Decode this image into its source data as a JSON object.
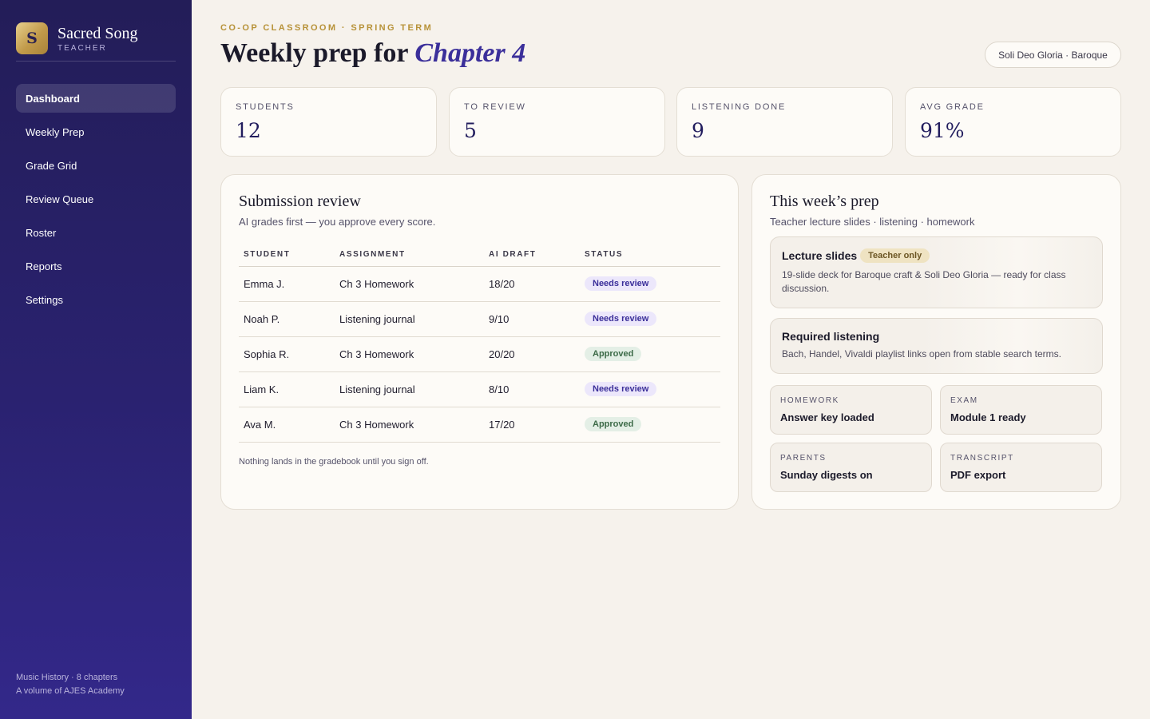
{
  "sidebar": {
    "logo_letter": "S",
    "app_name": "Sacred Song",
    "role": "TEACHER",
    "nav": [
      {
        "label": "Dashboard",
        "active": true
      },
      {
        "label": "Weekly Prep"
      },
      {
        "label": "Grade Grid"
      },
      {
        "label": "Review Queue"
      },
      {
        "label": "Roster"
      },
      {
        "label": "Reports"
      },
      {
        "label": "Settings"
      }
    ],
    "footer": {
      "line1": "Music History · 8 chapters",
      "line2": "A volume of AJES Academy"
    }
  },
  "header": {
    "eyebrow": "CO-OP CLASSROOM · SPRING TERM",
    "title_prefix": "Weekly prep for",
    "title_emphasis": "Chapter 4",
    "chip": "Soli Deo Gloria · Baroque"
  },
  "stats": [
    {
      "label": "STUDENTS",
      "value": "12"
    },
    {
      "label": "TO REVIEW",
      "value": "5"
    },
    {
      "label": "LISTENING DONE",
      "value": "9"
    },
    {
      "label": "AVG GRADE",
      "value": "91%"
    }
  ],
  "review": {
    "title": "Submission review",
    "subtitle": "AI grades first — you approve every score.",
    "columns": [
      "STUDENT",
      "ASSIGNMENT",
      "AI DRAFT",
      "STATUS"
    ],
    "rows": [
      {
        "student": "Emma J.",
        "assignment": "Ch 3 Homework",
        "draft": "18/20",
        "status": "Needs review"
      },
      {
        "student": "Noah P.",
        "assignment": "Listening journal",
        "draft": "9/10",
        "status": "Needs review"
      },
      {
        "student": "Sophia R.",
        "assignment": "Ch 3 Homework",
        "draft": "20/20",
        "status": "Approved"
      },
      {
        "student": "Liam K.",
        "assignment": "Listening journal",
        "draft": "8/10",
        "status": "Needs review"
      },
      {
        "student": "Ava M.",
        "assignment": "Ch 3 Homework",
        "draft": "17/20",
        "status": "Approved"
      }
    ],
    "footnote": "Nothing lands in the gradebook until you sign off."
  },
  "prep": {
    "title": "This week’s prep",
    "subtitle": "Teacher lecture slides · listening · homework",
    "lecture": {
      "title": "Lecture slides",
      "tag": "Teacher only",
      "desc": "19-slide deck for Baroque craft & Soli Deo Gloria — ready for class discussion."
    },
    "listening": {
      "title": "Required listening",
      "desc": "Bach, Handel, Vivaldi playlist links open from stable search terms."
    },
    "tiles": [
      {
        "label": "HOMEWORK",
        "value": "Answer key loaded"
      },
      {
        "label": "EXAM",
        "value": "Module 1 ready"
      },
      {
        "label": "PARENTS",
        "value": "Sunday digests on"
      },
      {
        "label": "TRANSCRIPT",
        "value": "PDF export"
      }
    ]
  },
  "colors": {
    "sidebar_top": "#231d58",
    "sidebar_bottom": "#33288a",
    "accent_gold": "#b79238",
    "accent_indigo": "#3b2f9a",
    "page_bg": "#f6f2ec"
  }
}
